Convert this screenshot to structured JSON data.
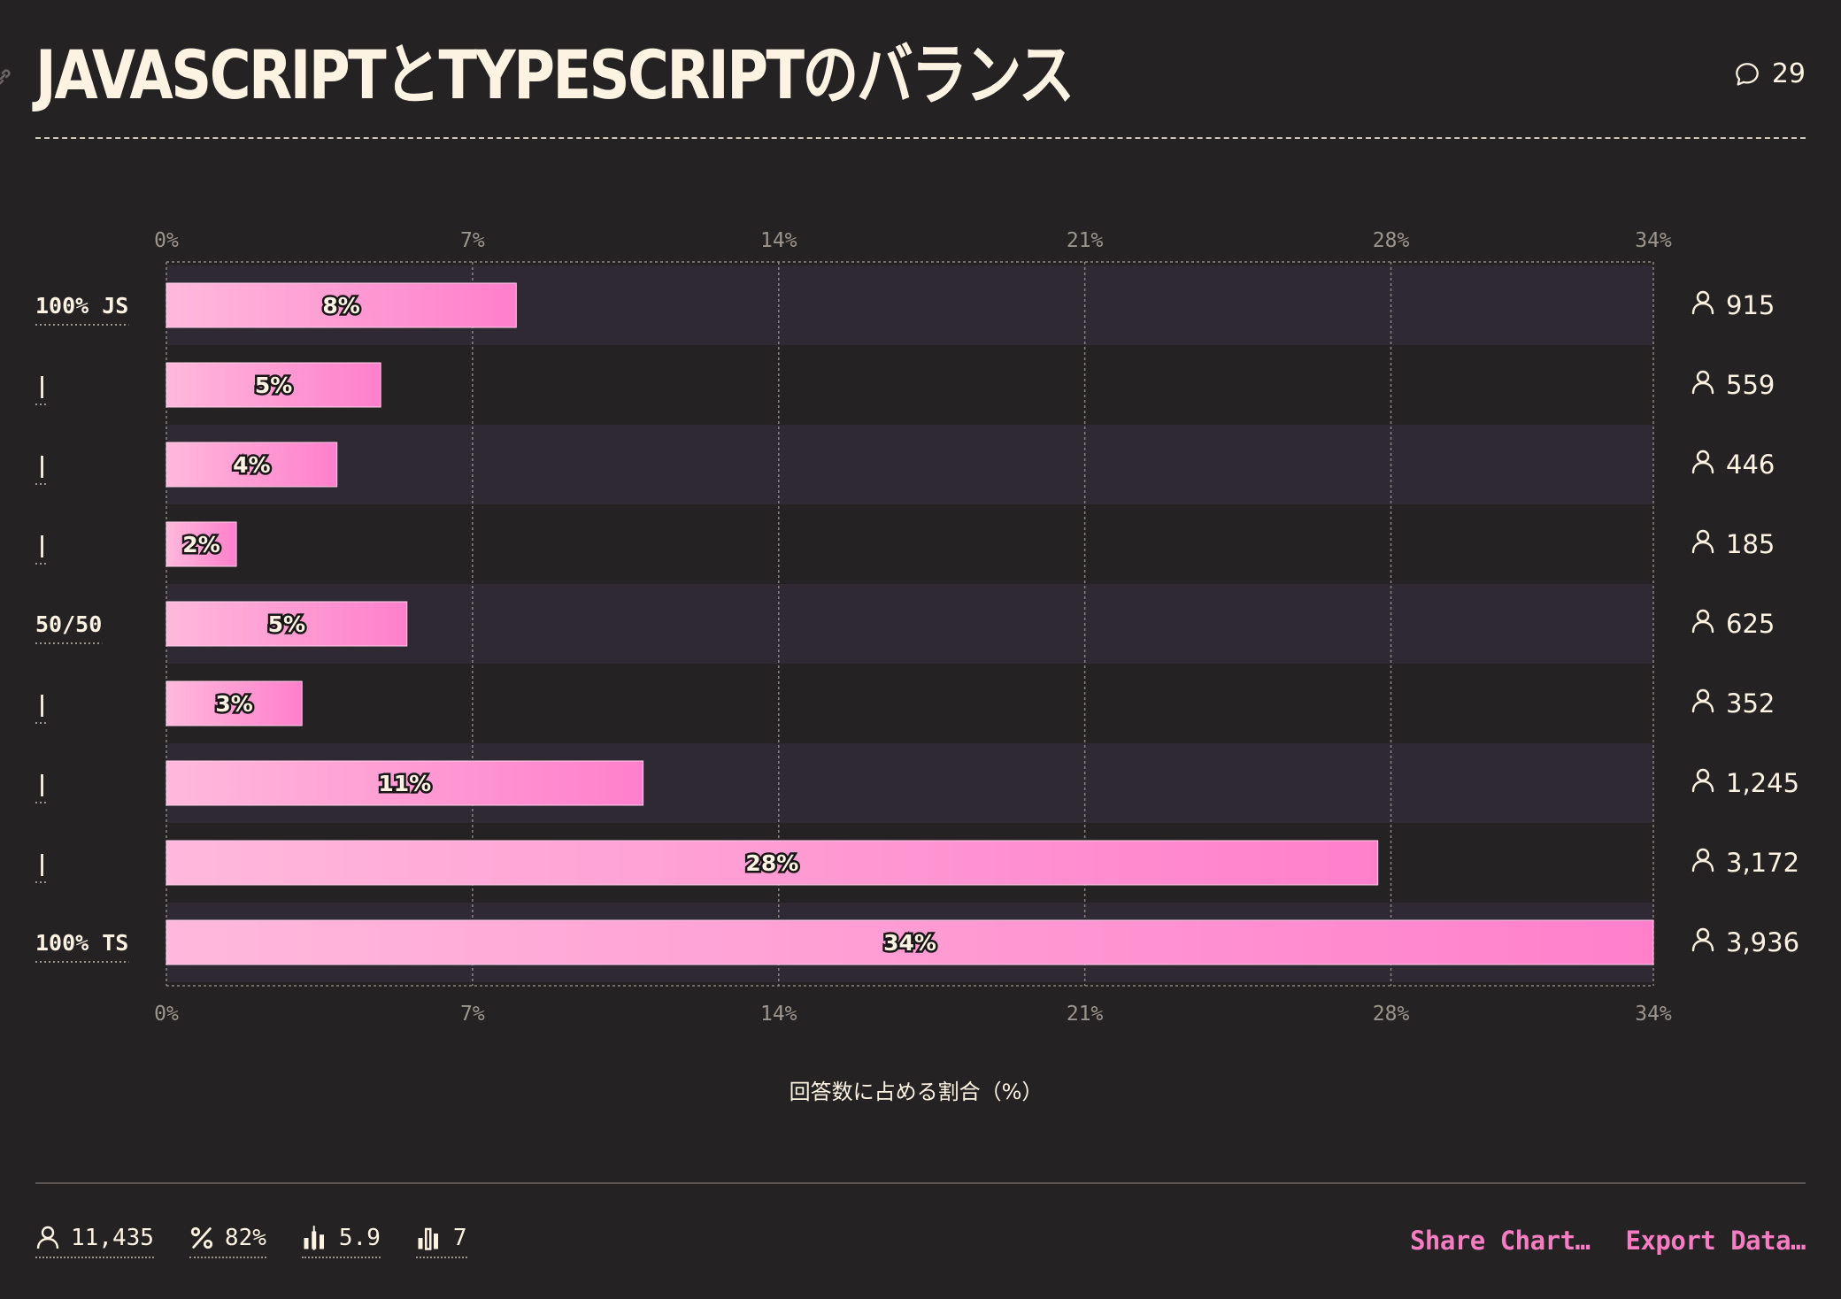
{
  "header": {
    "title": "JAVASCRIPTとTYPESCRIPTのバランス",
    "comment_count": "29"
  },
  "chart_data": {
    "type": "bar",
    "orientation": "horizontal",
    "title": "JAVASCRIPTとTYPESCRIPTのバランス",
    "xlabel": "回答数に占める割合（%）",
    "xlim": [
      0,
      34
    ],
    "ticks": [
      "0%",
      "7%",
      "14%",
      "21%",
      "28%",
      "34%"
    ],
    "tick_values": [
      0,
      7,
      14,
      21,
      28,
      34
    ],
    "grid": true,
    "categories": [
      "100% JS",
      "|",
      "|",
      "|",
      "50/50",
      "|",
      "|",
      "|",
      "100% TS"
    ],
    "values": [
      8,
      4.9,
      3.9,
      1.6,
      5.5,
      3.1,
      10.9,
      27.7,
      34.4
    ],
    "value_labels": [
      "8%",
      "5%",
      "4%",
      "2%",
      "5%",
      "3%",
      "11%",
      "28%",
      "34%"
    ],
    "counts": [
      "915",
      "559",
      "446",
      "185",
      "625",
      "352",
      "1,245",
      "3,172",
      "3,936"
    ],
    "bar_gradient": [
      "#ffb9dc",
      "#ff7fcb"
    ],
    "row_shade": "#2f2934"
  },
  "footer": {
    "stats": {
      "respondents": "11,435",
      "percent": "82%",
      "average": "5.9",
      "buckets": "7"
    },
    "actions": {
      "share": "Share Chart…",
      "export": "Export Data…"
    }
  },
  "colors": {
    "background": "#252223",
    "text": "#fdf3e3",
    "accent": "#f77dc3",
    "muted": "#9c958d"
  }
}
